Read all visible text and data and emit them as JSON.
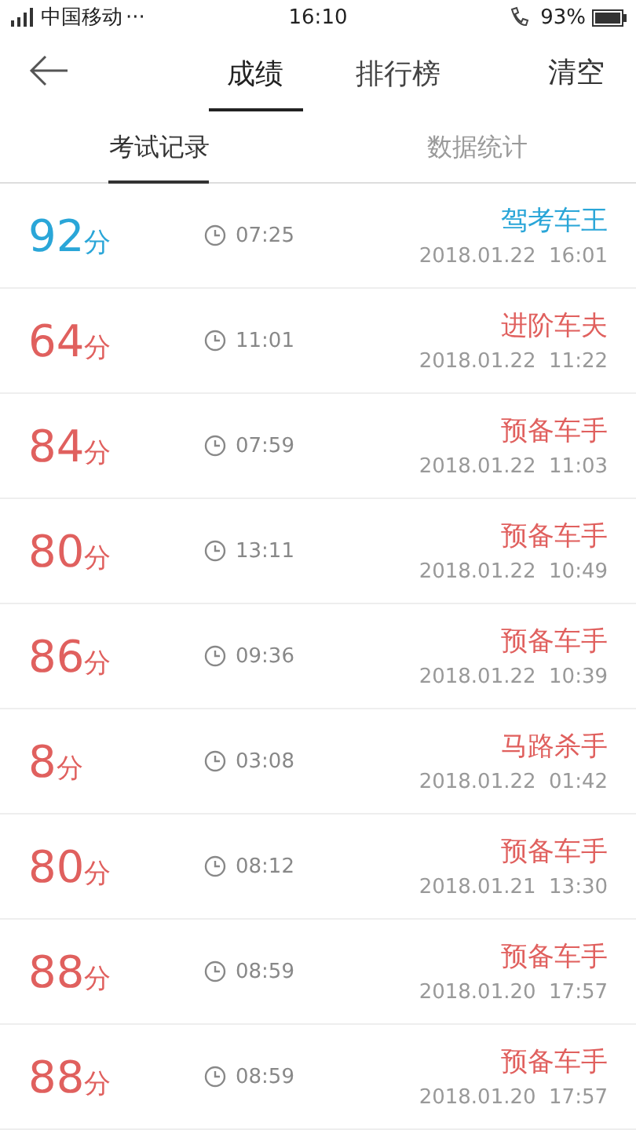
{
  "status_bar": {
    "carrier": "中国移动",
    "dots": "···",
    "time": "16:10",
    "battery": "93%"
  },
  "header": {
    "tabs": [
      {
        "label": "成绩",
        "selected": true
      },
      {
        "label": "排行榜",
        "selected": false
      }
    ],
    "action": "清空"
  },
  "sub_tabs": [
    {
      "label": "考试记录",
      "selected": true
    },
    {
      "label": "数据统计",
      "selected": false
    }
  ],
  "records": [
    {
      "score": "92",
      "unit": "分",
      "passed": true,
      "duration": "07:25",
      "title": "驾考车王",
      "date": "2018.01.22  16:01"
    },
    {
      "score": "64",
      "unit": "分",
      "passed": false,
      "duration": "11:01",
      "title": "进阶车夫",
      "date": "2018.01.22  11:22"
    },
    {
      "score": "84",
      "unit": "分",
      "passed": false,
      "duration": "07:59",
      "title": "预备车手",
      "date": "2018.01.22  11:03"
    },
    {
      "score": "80",
      "unit": "分",
      "passed": false,
      "duration": "13:11",
      "title": "预备车手",
      "date": "2018.01.22  10:49"
    },
    {
      "score": "86",
      "unit": "分",
      "passed": false,
      "duration": "09:36",
      "title": "预备车手",
      "date": "2018.01.22  10:39"
    },
    {
      "score": "8",
      "unit": "分",
      "passed": false,
      "duration": "03:08",
      "title": "马路杀手",
      "date": "2018.01.22  01:42"
    },
    {
      "score": "80",
      "unit": "分",
      "passed": false,
      "duration": "08:12",
      "title": "预备车手",
      "date": "2018.01.21  13:30"
    },
    {
      "score": "88",
      "unit": "分",
      "passed": false,
      "duration": "08:59",
      "title": "预备车手",
      "date": "2018.01.20  17:57"
    },
    {
      "score": "88",
      "unit": "分",
      "passed": false,
      "duration": "08:59",
      "title": "预备车手",
      "date": "2018.01.20  17:57"
    }
  ]
}
